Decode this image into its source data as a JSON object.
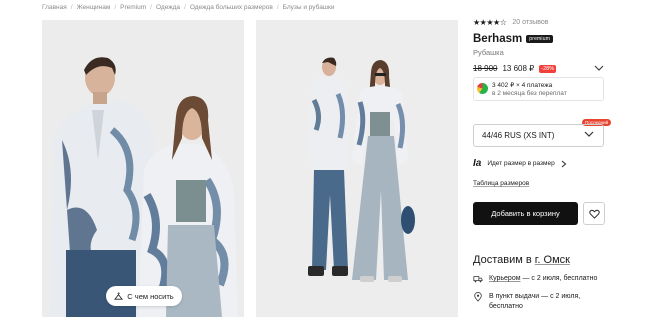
{
  "breadcrumb": [
    "Главная",
    "Женщинам",
    "Premium",
    "Одежда",
    "Одежда больших размеров",
    "Блузы и рубашки"
  ],
  "look_button": {
    "label": "С чем носить"
  },
  "product": {
    "rating_stars": "★★★★☆",
    "reviews": "20 отзывов",
    "brand": "Berhasm",
    "premium_badge": "premium",
    "type": "Рубашка",
    "old_price": "18 900",
    "new_price": "13 608 ₽",
    "discount": "-28%",
    "split_line1": "3 402 ₽ × 4 платежа",
    "split_line2": "в 2 месяца без переплат",
    "size_selected": "44/46 RUS (XS INT)",
    "last_badge": "Последний",
    "fit_logo": "Ia",
    "fit_text": "Идет размер в размер",
    "size_table_link": "Таблица размеров",
    "add_to_cart": "Добавить в корзину"
  },
  "delivery": {
    "title_prefix": "Доставим в",
    "city": "г. Омск",
    "courier_label": "Курьером",
    "courier_text": " — с 2 июля, бесплатно",
    "pickup_line1": "В пункт выдачи — с 2 июля,",
    "pickup_line2": "бесплатно"
  },
  "colors": {
    "accent_red": "#f2413b",
    "button_dark": "#111111",
    "split_green": "#28b24b"
  },
  "icons": [
    "look-icon",
    "chevron-down-icon",
    "split-logo-icon",
    "heart-icon",
    "truck-icon",
    "pin-icon"
  ]
}
